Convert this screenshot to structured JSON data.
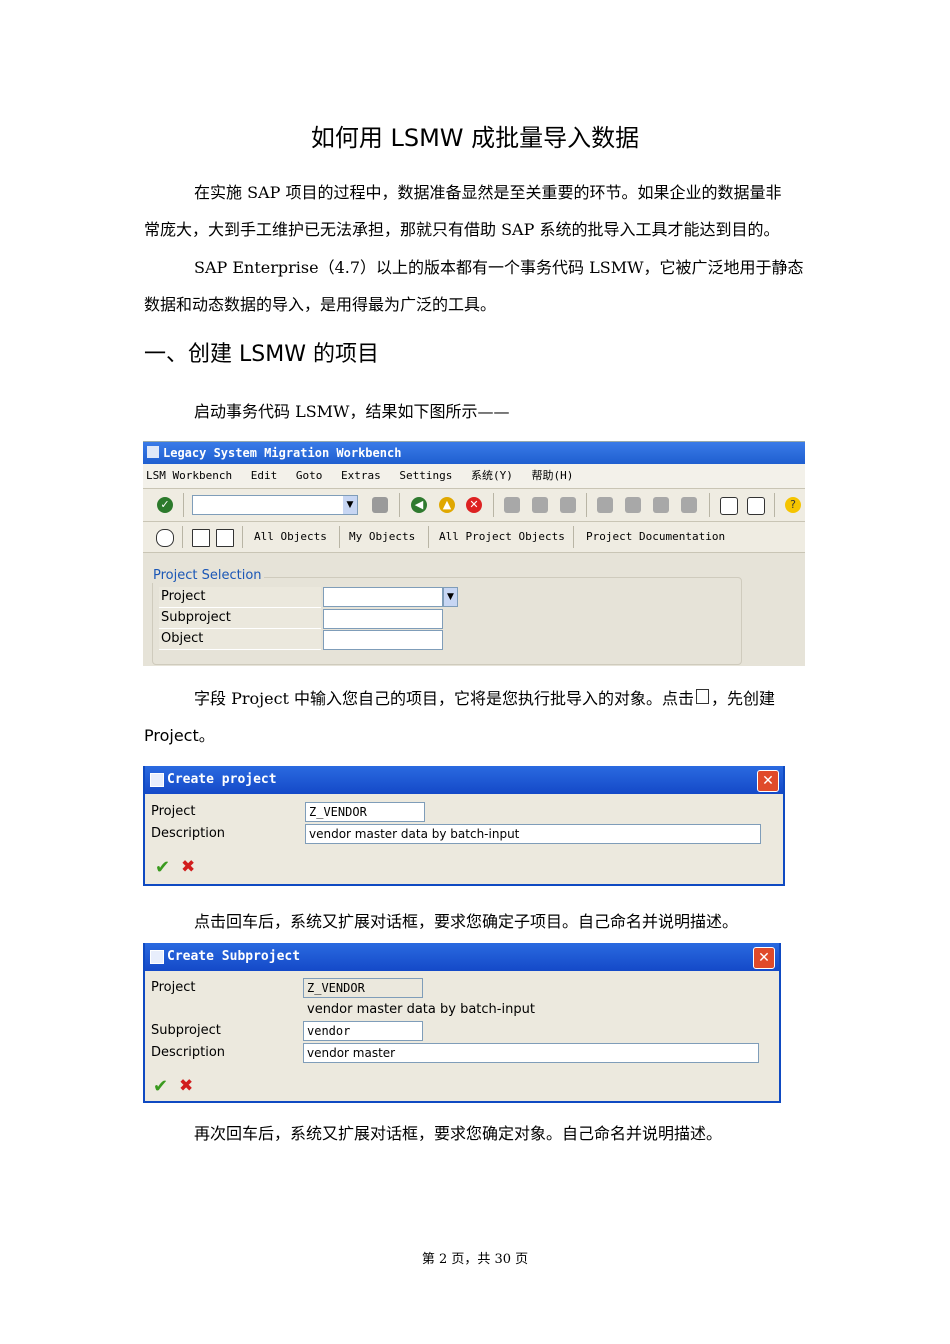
{
  "doc": {
    "title": "如何用 LSMW 成批量导入数据",
    "p1_line1": "在实施 SAP 项目的过程中，数据准备显然是至关重要的环节。如果企业的数据量非",
    "p1_line2": "常庞大，大到手工维护已无法承担，那就只有借助 SAP 系统的批导入工具才能达到目的。",
    "p2_line1": "SAP Enterprise（4.7）以上的版本都有一个事务代码 LSMW，它被广泛地用于静态",
    "p2_line2": "数据和动态数据的导入，是用得最为广泛的工具。",
    "heading1": "一、创建 LSMW 的项目",
    "p3": "启动事务代码 LSMW，结果如下图所示——",
    "p4_line1_a": "字段 Project 中输入您自己的项目，它将是您执行批导入的对象。点击",
    "p4_line1_b": "，先创建",
    "p4_line2": "Project。",
    "p5": "点击回车后，系统又扩展对话框，要求您确定子项目。自己命名并说明描述。",
    "p6": "再次回车后，系统又扩展对话框，要求您确定对象。自己命名并说明描述。",
    "footer": "第 2 页，共 30 页"
  },
  "sap_main": {
    "window_title": "Legacy System Migration Workbench",
    "menu": [
      "LSM Workbench",
      "Edit",
      "Goto",
      "Extras",
      "Settings",
      "系统(Y)",
      "帮助(H)"
    ],
    "toolbar2": [
      "All Objects",
      "My Objects",
      "All Project Objects",
      "Project Documentation"
    ],
    "group_title": "Project Selection",
    "fields": [
      "Project",
      "Subproject",
      "Object"
    ]
  },
  "create_project": {
    "title": "Create project",
    "label_project": "Project",
    "label_description": "Description",
    "project_value": "Z_VENDOR",
    "description_value": "vendor master data by batch-input"
  },
  "create_subproject": {
    "title": "Create Subproject",
    "label_project": "Project",
    "project_value": "Z_VENDOR",
    "project_desc": "vendor master data by batch-input",
    "label_subproject": "Subproject",
    "subproject_value": "vendor",
    "label_description": "Description",
    "description_value": "vendor master"
  },
  "colors": {
    "title_blue": "#1f5fd0",
    "group_title": "#1b57b6",
    "ok_green": "#3a9a1e",
    "cancel_red": "#d11d1d"
  }
}
